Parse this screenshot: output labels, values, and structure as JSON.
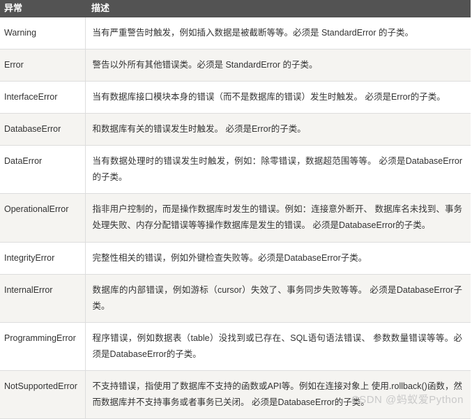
{
  "table": {
    "columns": [
      {
        "key": "name",
        "label": "异常"
      },
      {
        "key": "description",
        "label": "描述"
      }
    ],
    "header_background": "#535353",
    "header_text_color": "#ffffff",
    "row_background_odd": "#ffffff",
    "row_background_even": "#f5f4f1",
    "border_color": "#dddddd",
    "text_color": "#333333",
    "rows": [
      {
        "name": "Warning",
        "description": "当有严重警告时触发，例如插入数据是被截断等等。必须是 StandardError 的子类。"
      },
      {
        "name": "Error",
        "description": "警告以外所有其他错误类。必须是 StandardError 的子类。"
      },
      {
        "name": "InterfaceError",
        "description": "当有数据库接口模块本身的错误（而不是数据库的错误）发生时触发。 必须是Error的子类。"
      },
      {
        "name": "DatabaseError",
        "description": "和数据库有关的错误发生时触发。 必须是Error的子类。"
      },
      {
        "name": "DataError",
        "description": "当有数据处理时的错误发生时触发，例如：除零错误，数据超范围等等。 必须是DatabaseError的子类。"
      },
      {
        "name": "OperationalError",
        "description": "指非用户控制的，而是操作数据库时发生的错误。例如：连接意外断开、 数据库名未找到、事务处理失败、内存分配错误等等操作数据库是发生的错误。 必须是DatabaseError的子类。"
      },
      {
        "name": "IntegrityError",
        "description": "完整性相关的错误，例如外键检查失败等。必须是DatabaseError子类。"
      },
      {
        "name": "InternalError",
        "description": "数据库的内部错误，例如游标（cursor）失效了、事务同步失败等等。 必须是DatabaseError子类。"
      },
      {
        "name": "ProgrammingError",
        "description": "程序错误，例如数据表（table）没找到或已存在、SQL语句语法错误、 参数数量错误等等。必须是DatabaseError的子类。"
      },
      {
        "name": "NotSupportedError",
        "description": "不支持错误，指使用了数据库不支持的函数或API等。例如在连接对象上 使用.rollback()函数，然而数据库并不支持事务或者事务已关闭。 必须是DatabaseError的子类。"
      }
    ]
  },
  "watermark": {
    "text": "CSDN @蚂蚁爱Python",
    "color": "#c9c9c9"
  }
}
